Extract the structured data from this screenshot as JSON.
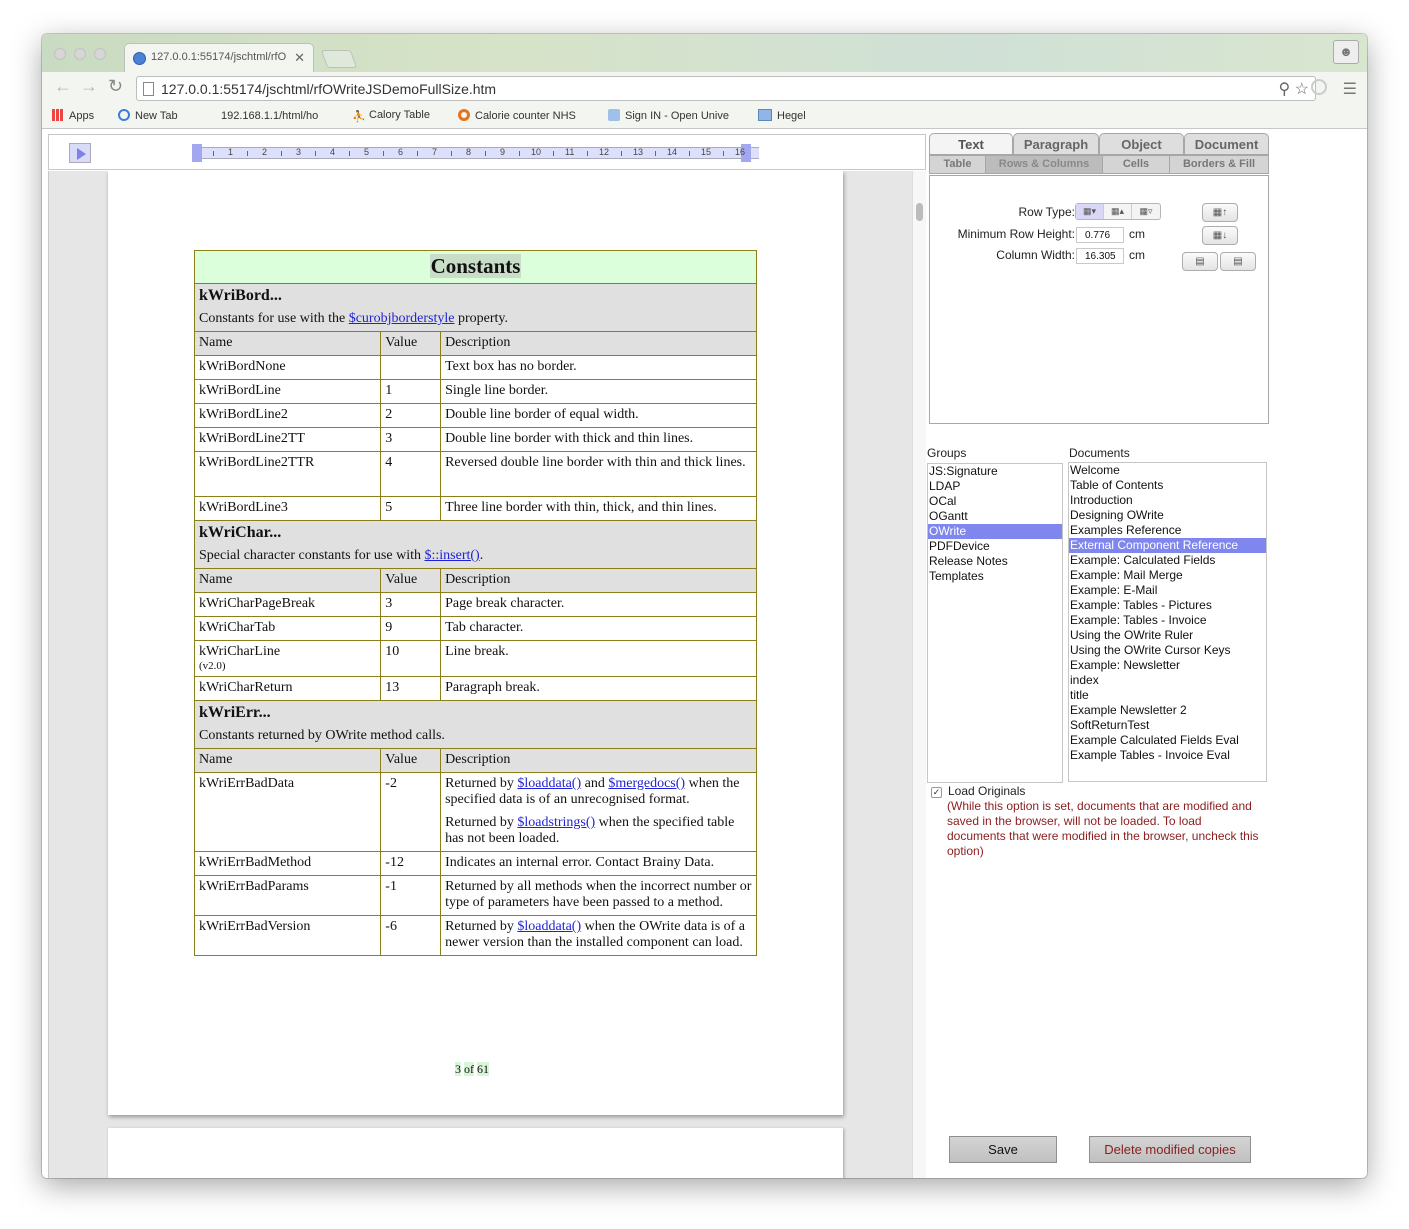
{
  "browser": {
    "tab_title": "127.0.0.1:55174/jschtml/rfO",
    "tab_close": "✕",
    "url": "127.0.0.1:55174/jschtml/rfOWriteJSDemoFullSize.htm",
    "bookmarks": [
      {
        "label": "Apps",
        "icon": "apps-grid-icon"
      },
      {
        "label": "New Tab",
        "icon": "google-icon"
      },
      {
        "label": "192.168.1.1/html/ho",
        "icon": "page-icon"
      },
      {
        "label": "Calory Table",
        "icon": "runner-icon"
      },
      {
        "label": "Calorie counter NHS",
        "icon": "target-icon"
      },
      {
        "label": "Sign IN - Open Unive",
        "icon": "shield-icon"
      },
      {
        "label": "Hegel",
        "icon": "folder-icon"
      }
    ]
  },
  "ruler": {
    "numbers": [
      "1",
      "2",
      "3",
      "4",
      "5",
      "6",
      "7",
      "8",
      "9",
      "10",
      "11",
      "12",
      "13",
      "14",
      "15",
      "16"
    ]
  },
  "document": {
    "title": "Constants",
    "sections": [
      {
        "heading": "kWriBord...",
        "desc_before": "Constants for use with the ",
        "desc_link": "$curobjborderstyle",
        "desc_after": " property.",
        "headers": [
          "Name",
          "Value",
          "Description"
        ],
        "rows": [
          {
            "name": "kWriBordNone",
            "value": "",
            "desc": "Text box has no border."
          },
          {
            "name": "kWriBordLine",
            "value": "1",
            "desc": "Single line border."
          },
          {
            "name": "kWriBordLine2",
            "value": "2",
            "desc": "Double line border of equal width."
          },
          {
            "name": "kWriBordLine2TT",
            "value": "3",
            "desc": "Double line border with thick and thin lines."
          },
          {
            "name": "kWriBordLine2TTR",
            "value": "4",
            "desc": "Reversed double line border with thin and thick lines."
          },
          {
            "name": "kWriBordLine3",
            "value": "5",
            "desc": "Three line border with thin, thick, and thin lines."
          }
        ]
      },
      {
        "heading": "kWriChar...",
        "desc_before": "Special character constants for use with ",
        "desc_link": "$::insert()",
        "desc_after": ".",
        "headers": [
          "Name",
          "Value",
          "Description"
        ],
        "rows": [
          {
            "name": "kWriCharPageBreak",
            "value": "3",
            "desc": "Page break character."
          },
          {
            "name": "kWriCharTab",
            "value": "9",
            "desc": "Tab character."
          },
          {
            "name": "kWriCharLine",
            "note": "(v2.0)",
            "value": "10",
            "desc": "Line break."
          },
          {
            "name": "kWriCharReturn",
            "value": "13",
            "desc": "Paragraph break."
          }
        ]
      },
      {
        "heading": "kWriErr...",
        "desc": "Constants returned by OWrite method calls.",
        "headers": [
          "Name",
          "Value",
          "Description"
        ],
        "rows": [
          {
            "name": "kWriErrBadData",
            "value": "-2",
            "d1_pre": "Returned by ",
            "d1_link1": "$loaddata()",
            "d1_mid": " and ",
            "d1_link2": "$mergedocs()",
            "d1_post": " when the specified data is of an unrecognised format.",
            "d2_pre": "Returned by ",
            "d2_link": "$loadstrings()",
            "d2_post": " when the specified table has not been loaded."
          },
          {
            "name": "kWriErrBadMethod",
            "value": "-12",
            "desc": "Indicates an internal error. Contact Brainy Data."
          },
          {
            "name": "kWriErrBadParams",
            "value": "-1",
            "desc": "Returned by all methods when the incorrect number or type of parameters have been passed to a method."
          },
          {
            "name": "kWriErrBadVersion",
            "value": "-6",
            "d_pre": "Returned by ",
            "d_link": "$loaddata()",
            "d_post": " when the OWrite data is of a newer version than the installed component can load."
          }
        ]
      }
    ],
    "page_current": "3",
    "page_of": "of",
    "page_total": "61"
  },
  "panel": {
    "tabs_row1": [
      "Text",
      "Paragraph",
      "Object",
      "Document"
    ],
    "tabs_row2": [
      "Table",
      "Rows & Columns",
      "Cells",
      "Borders & Fill"
    ],
    "active_tab1": "Text",
    "active_tab2": "Rows & Columns",
    "row_type_label": "Row Type:",
    "min_row_height_label": "Minimum Row Height:",
    "min_row_height_value": "0.776",
    "column_width_label": "Column Width:",
    "column_width_value": "16.305",
    "unit": "cm"
  },
  "groups": {
    "label": "Groups",
    "items": [
      "JS:Signature",
      "LDAP",
      "OCal",
      "OGantt",
      "OWrite",
      "PDFDevice",
      "Release Notes",
      "Templates"
    ],
    "selected": "OWrite"
  },
  "documents": {
    "label": "Documents",
    "items": [
      "Welcome",
      "Table of Contents",
      "Introduction",
      "Designing OWrite",
      "Examples Reference",
      "External Component Reference",
      "Example: Calculated Fields",
      "Example: Mail Merge",
      "Example: E-Mail",
      "Example: Tables - Pictures",
      "Example: Tables - Invoice",
      "Using the OWrite Ruler",
      "Using the OWrite Cursor Keys",
      "Example: Newsletter",
      "index",
      "title",
      "Example Newsletter 2",
      "SoftReturnTest",
      "Example Calculated Fields Eval",
      "Example Tables - Invoice Eval"
    ],
    "selected": "External Component Reference"
  },
  "options": {
    "load_originals_label": "Load Originals",
    "load_originals_checked": true,
    "note": "(While this option is set, documents that are modified and saved in the browser, will not be loaded. To load documents that were modified in the browser, uncheck this option)"
  },
  "buttons": {
    "save": "Save",
    "delete": "Delete modified copies"
  },
  "colors": {
    "selection": "#7f86ee",
    "note": "#8b1d1d",
    "table_border": "#8c7e18",
    "title_bg": "#dbffdb"
  }
}
